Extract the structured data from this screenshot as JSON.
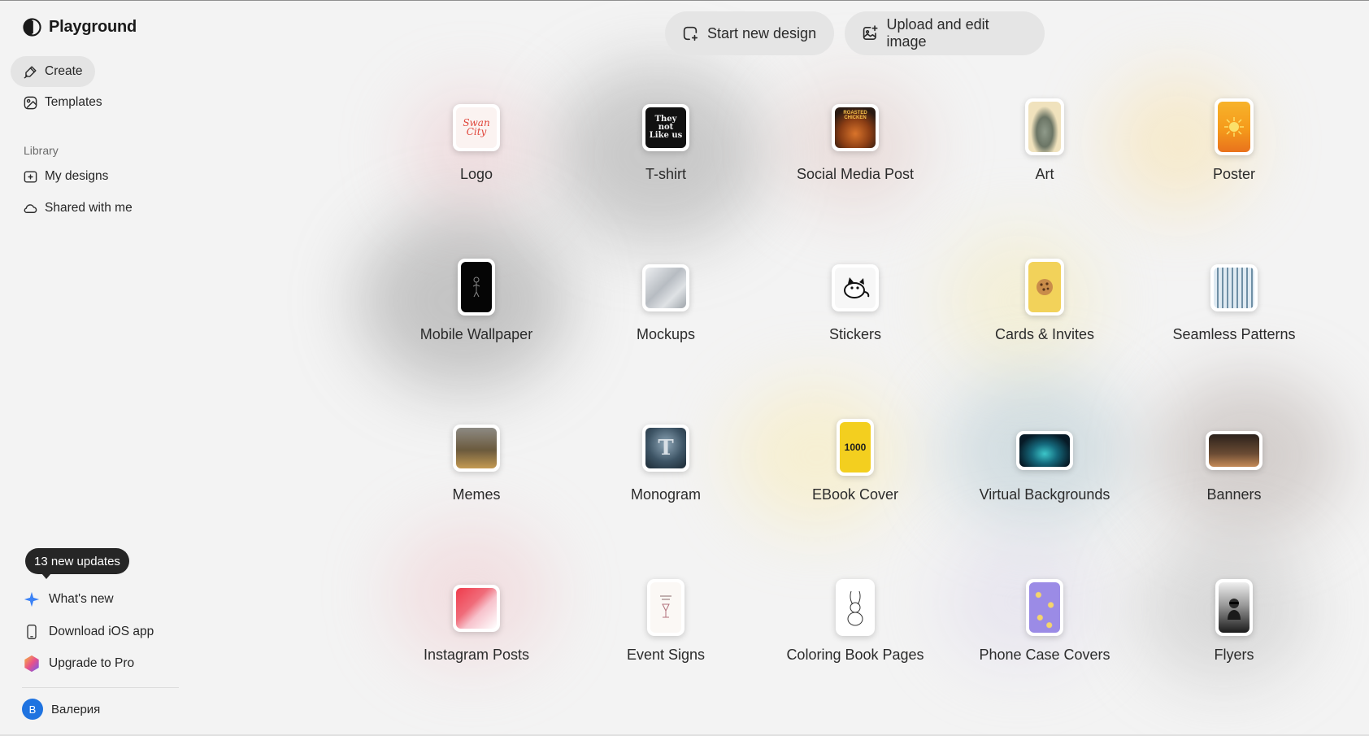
{
  "app": {
    "name": "Playground"
  },
  "sidebar": {
    "nav": [
      {
        "label": "Create",
        "icon": "brush-icon",
        "active": true
      },
      {
        "label": "Templates",
        "icon": "templates-icon",
        "active": false
      }
    ],
    "library_label": "Library",
    "library": [
      {
        "label": "My designs",
        "icon": "folder-plus-icon"
      },
      {
        "label": "Shared with me",
        "icon": "cloud-icon"
      }
    ],
    "updates_badge": "13 new updates",
    "footer": [
      {
        "label": "What's new",
        "icon": "sparkle-icon"
      },
      {
        "label": "Download iOS app",
        "icon": "phone-icon"
      },
      {
        "label": "Upgrade to Pro",
        "icon": "pro-gradient-icon"
      }
    ],
    "user": {
      "initial": "В",
      "name": "Валерия"
    }
  },
  "actions": {
    "start_new_design": "Start new design",
    "upload_and_edit": "Upload and edit image"
  },
  "categories": [
    {
      "label": "Logo",
      "thumb_text": "Swan City"
    },
    {
      "label": "T-shirt",
      "thumb_text": "They not Like us"
    },
    {
      "label": "Social Media Post",
      "thumb_text": "ROASTED CHICKEN"
    },
    {
      "label": "Art",
      "thumb_text": ""
    },
    {
      "label": "Poster",
      "thumb_text": ""
    },
    {
      "label": "Mobile Wallpaper",
      "thumb_text": ""
    },
    {
      "label": "Mockups",
      "thumb_text": ""
    },
    {
      "label": "Stickers",
      "thumb_text": ""
    },
    {
      "label": "Cards & Invites",
      "thumb_text": ""
    },
    {
      "label": "Seamless Patterns",
      "thumb_text": ""
    },
    {
      "label": "Memes",
      "thumb_text": ""
    },
    {
      "label": "Monogram",
      "thumb_text": ""
    },
    {
      "label": "EBook Cover",
      "thumb_text": "1000"
    },
    {
      "label": "Virtual Backgrounds",
      "thumb_text": ""
    },
    {
      "label": "Banners",
      "thumb_text": ""
    },
    {
      "label": "Instagram Posts",
      "thumb_text": ""
    },
    {
      "label": "Event Signs",
      "thumb_text": ""
    },
    {
      "label": "Coloring Book Pages",
      "thumb_text": ""
    },
    {
      "label": "Phone Case Covers",
      "thumb_text": ""
    },
    {
      "label": "Flyers",
      "thumb_text": ""
    }
  ],
  "colors": {
    "background": "#f3f3f3",
    "active_nav": "#e4e4e4",
    "button_bg": "#e5e5e5",
    "badge_bg": "#262626",
    "avatar": "#1f73e0",
    "sparkle": "#3b82f6"
  }
}
